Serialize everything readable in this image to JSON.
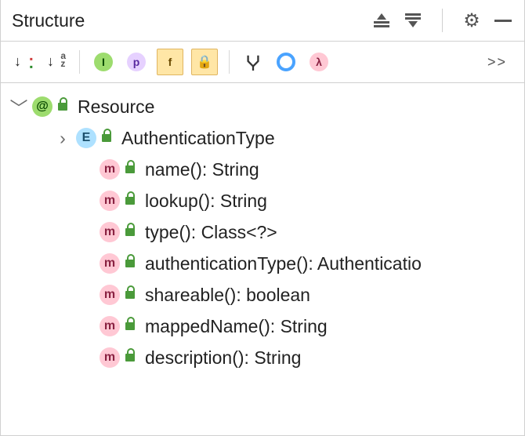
{
  "panel": {
    "title": "Structure"
  },
  "titlebar_actions": {
    "expand_all": "Expand All",
    "collapse_all": "Collapse All",
    "settings": "Settings",
    "hide": "Hide"
  },
  "toolbar": {
    "sort_visibility": "Sort by Visibility",
    "sort_alpha": "Sort Alphabetically",
    "show_interfaces_label": "I",
    "show_properties_label": "p",
    "show_fields_label": "f",
    "show_nonpublic_label": "🔒",
    "show_inherited": "Show Inherited",
    "show_anonymous": "Show Anonymous",
    "show_lambdas_label": "λ",
    "more_label": ">>"
  },
  "tree": {
    "root": {
      "kind_label": "@",
      "name": "Resource",
      "children": [
        {
          "kind_label": "E",
          "name": "AuthenticationType",
          "has_children": true
        },
        {
          "kind_label": "m",
          "name": "name(): String"
        },
        {
          "kind_label": "m",
          "name": "lookup(): String"
        },
        {
          "kind_label": "m",
          "name": "type(): Class<?>"
        },
        {
          "kind_label": "m",
          "name": "authenticationType(): Authenticatio"
        },
        {
          "kind_label": "m",
          "name": "shareable(): boolean"
        },
        {
          "kind_label": "m",
          "name": "mappedName(): String"
        },
        {
          "kind_label": "m",
          "name": "description(): String"
        }
      ]
    }
  }
}
